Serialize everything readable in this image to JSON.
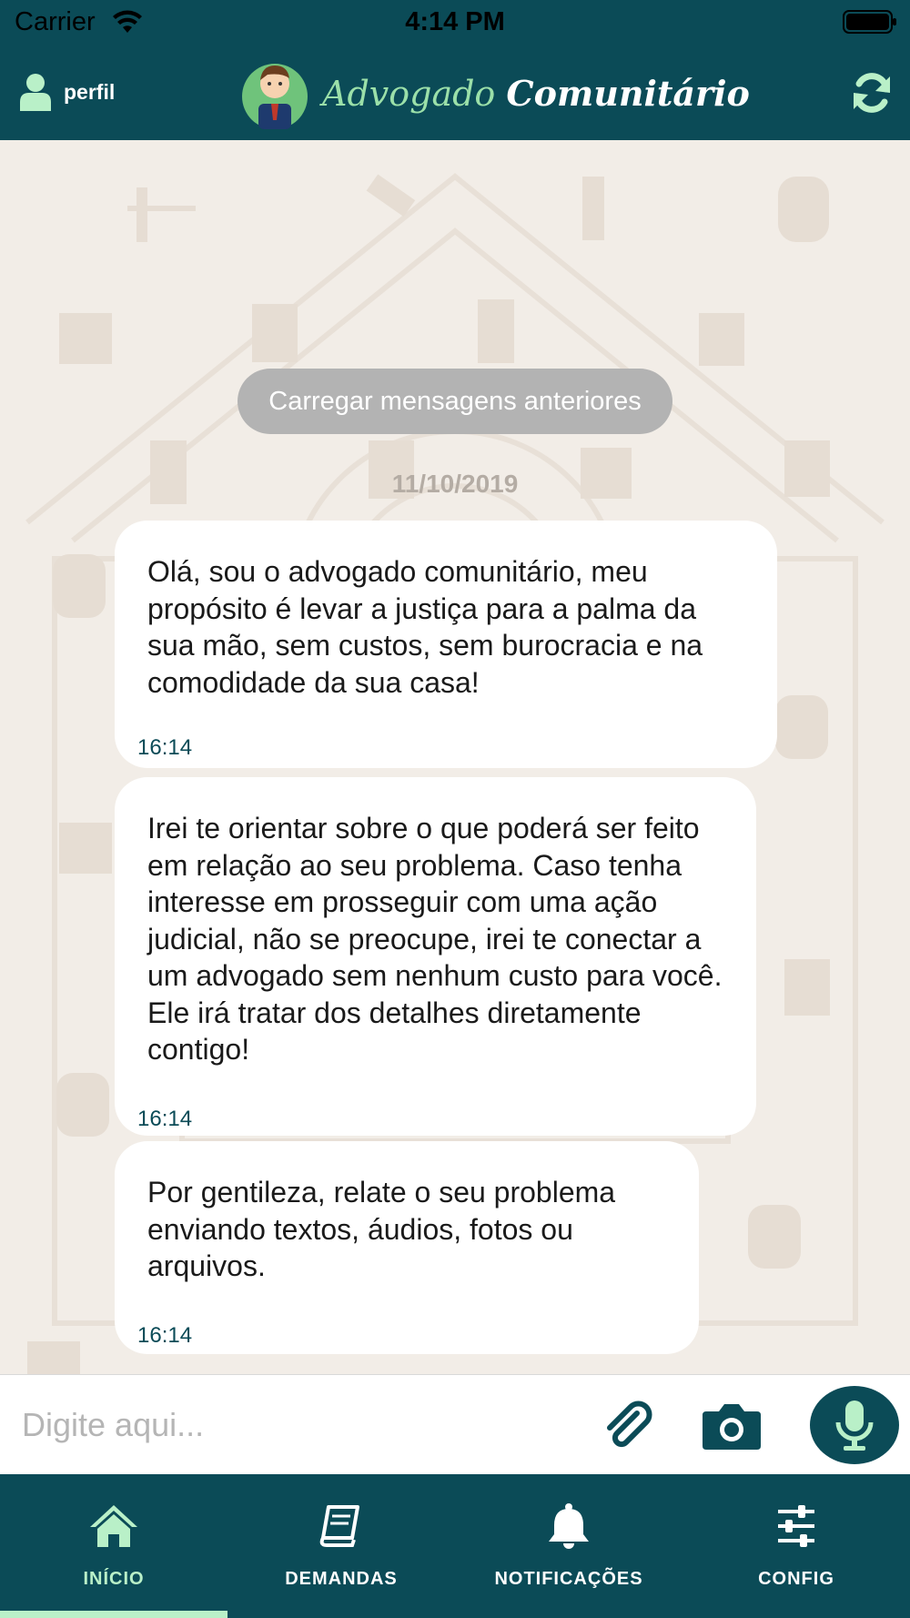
{
  "status_bar": {
    "carrier": "Carrier",
    "time": "4:14 PM"
  },
  "header": {
    "profile_label": "perfil",
    "brand_first": "Advogado",
    "brand_second": "Comunitário"
  },
  "chat": {
    "load_more": "Carregar mensagens anteriores",
    "date": "11/10/2019",
    "messages": [
      {
        "text": "Olá, sou o advogado comunitário, meu propósito é levar a justiça para a palma da sua mão, sem custos, sem burocracia e na comodidade da sua casa!",
        "time": "16:14"
      },
      {
        "text": "Irei te orientar sobre o que poderá ser feito em relação ao seu problema. Caso tenha interesse em prosseguir com uma ação judicial, não se preocupe, irei te conectar a um advogado sem nenhum custo para você. Ele irá tratar dos detalhes diretamente contigo!",
        "time": "16:14"
      },
      {
        "text": "Por gentileza, relate o seu problema enviando textos, áudios, fotos ou arquivos.",
        "time": "16:14"
      }
    ]
  },
  "composer": {
    "placeholder": "Digite aqui..."
  },
  "tabs": [
    {
      "label": "INÍCIO",
      "icon": "home-icon",
      "active": true
    },
    {
      "label": "DEMANDAS",
      "icon": "book-icon",
      "active": false
    },
    {
      "label": "NOTIFICAÇÕES",
      "icon": "bell-icon",
      "active": false
    },
    {
      "label": "CONFIG",
      "icon": "sliders-icon",
      "active": false
    }
  ],
  "colors": {
    "primary": "#0b4b57",
    "accent": "#b9f0c8",
    "background": "#f2ede7"
  }
}
